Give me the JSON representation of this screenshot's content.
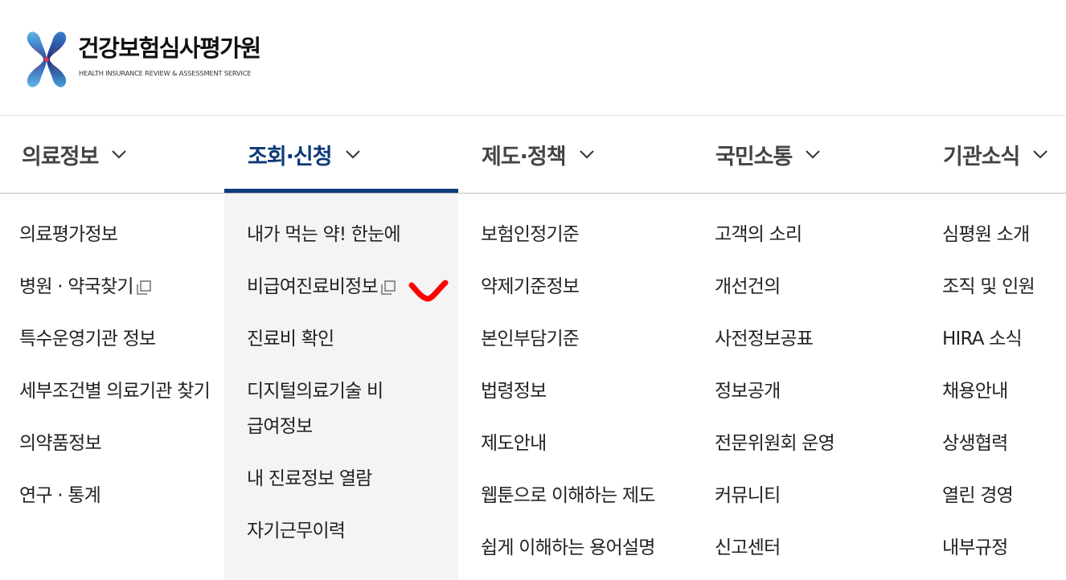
{
  "brand": {
    "name": "건강보험심사평가원",
    "subtitle": "HEALTH INSURANCE REVIEW & ASSESSMENT SERVICE"
  },
  "nav": {
    "menus": [
      {
        "label": "의료정보"
      },
      {
        "label": "조회·신청"
      },
      {
        "label": "제도·정책"
      },
      {
        "label": "국민소통"
      },
      {
        "label": "기관소식"
      }
    ],
    "active_index": 1
  },
  "columns": [
    {
      "items": [
        {
          "label": "의료평가정보"
        },
        {
          "label": "병원 · 약국찾기",
          "icon": "external-window-icon"
        },
        {
          "label": "특수운영기관 정보"
        },
        {
          "label": "세부조건별 의료기관 찾기"
        },
        {
          "label": "의약품정보"
        },
        {
          "label": "연구 · 통계"
        }
      ]
    },
    {
      "items": [
        {
          "label": "내가 먹는 약! 한눈에"
        },
        {
          "label": "비급여진료비정보",
          "icon": "external-window-icon"
        },
        {
          "label": "진료비 확인"
        },
        {
          "label": "디지털의료기술 비급여정보"
        },
        {
          "label": "내 진료정보 열람"
        },
        {
          "label": "자기근무이력"
        }
      ]
    },
    {
      "items": [
        {
          "label": "보험인정기준"
        },
        {
          "label": "약제기준정보"
        },
        {
          "label": "본인부담기준"
        },
        {
          "label": "법령정보"
        },
        {
          "label": "제도안내"
        },
        {
          "label": "웹툰으로 이해하는 제도"
        },
        {
          "label": "쉽게 이해하는 용어설명"
        }
      ]
    },
    {
      "items": [
        {
          "label": "고객의 소리"
        },
        {
          "label": "개선건의"
        },
        {
          "label": "사전정보공표"
        },
        {
          "label": "정보공개"
        },
        {
          "label": "전문위원회 운영"
        },
        {
          "label": "커뮤니티"
        },
        {
          "label": "신고센터"
        }
      ]
    },
    {
      "items": [
        {
          "label": "심평원 소개"
        },
        {
          "label": "조직 및 인원"
        },
        {
          "label": "HIRA 소식"
        },
        {
          "label": "채용안내"
        },
        {
          "label": "상생협력"
        },
        {
          "label": "열린 경영"
        },
        {
          "label": "내부규정"
        }
      ]
    }
  ],
  "colors": {
    "accent": "#0d3a78",
    "check_mark": "#ff0000",
    "active_column_bg": "#f4f4f4"
  }
}
